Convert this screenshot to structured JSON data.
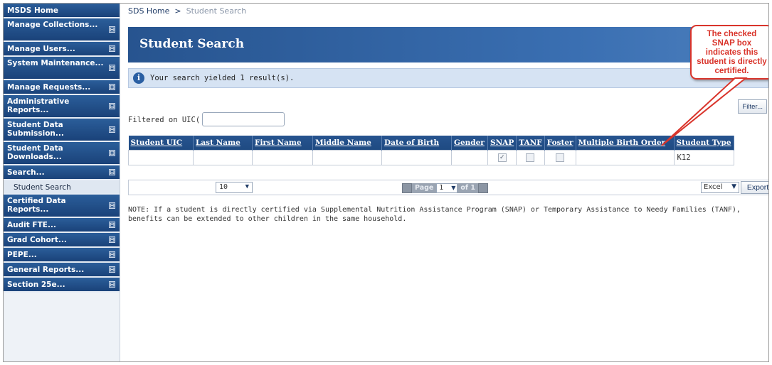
{
  "sidebar": {
    "items": [
      {
        "label": "MSDS Home",
        "expand": false
      },
      {
        "label": "Manage Collections...",
        "expand": true
      },
      {
        "label": "Manage Users...",
        "expand": true
      },
      {
        "label": "System Maintenance...",
        "expand": true
      },
      {
        "label": "Manage Requests...",
        "expand": true
      },
      {
        "label": "Administrative Reports...",
        "expand": true
      },
      {
        "label": "Student Data Submission...",
        "expand": true
      },
      {
        "label": "Student Data Downloads...",
        "expand": true
      },
      {
        "label": "Search...",
        "expand": true
      },
      {
        "label": "Certified Data Reports...",
        "expand": true
      },
      {
        "label": "Audit FTE...",
        "expand": true
      },
      {
        "label": "Grad Cohort...",
        "expand": true
      },
      {
        "label": "PEPE...",
        "expand": true
      },
      {
        "label": "General Reports...",
        "expand": true
      },
      {
        "label": "Section 25e...",
        "expand": true
      }
    ],
    "sub_item": "Student Search",
    "expand_glyph": "⊟"
  },
  "breadcrumb": {
    "home": "SDS Home",
    "separator": ">",
    "current": "Student Search"
  },
  "page_title": "Student Search",
  "result_message": "Your search yielded 1 result(s).",
  "info_icon": "i",
  "filter": {
    "label": "Filtered on UIC(",
    "value": "",
    "button": "Filter..."
  },
  "table": {
    "columns": [
      "Student UIC",
      "Last Name",
      "First Name",
      "Middle Name",
      "Date of Birth",
      "Gender",
      "SNAP",
      "TANF",
      "Foster",
      "Multiple Birth Order",
      "Student Type"
    ],
    "rows": [
      {
        "uic": "",
        "last": "",
        "first": "",
        "middle": "",
        "dob": "",
        "gender": "",
        "snap": true,
        "tanf": false,
        "foster": false,
        "mbo": "",
        "type": "K12"
      }
    ]
  },
  "pager": {
    "page_size": "10",
    "page_label": "Page",
    "current_page": "1",
    "of_label": "of 1",
    "export_format": "Excel",
    "export_button": "Export"
  },
  "note": "NOTE: If a student is directly certified via Supplemental Nutrition Assistance Program (SNAP) or Temporary Assistance to Needy Families (TANF), benefits can be extended to other children in the same household.",
  "callout": "The checked SNAP box indicates this student is directly certified.",
  "colors": {
    "nav_blue": "#1a4279",
    "title_blue": "#27548f",
    "callout_red": "#d9342b",
    "result_bar": "#d6e3f3"
  }
}
